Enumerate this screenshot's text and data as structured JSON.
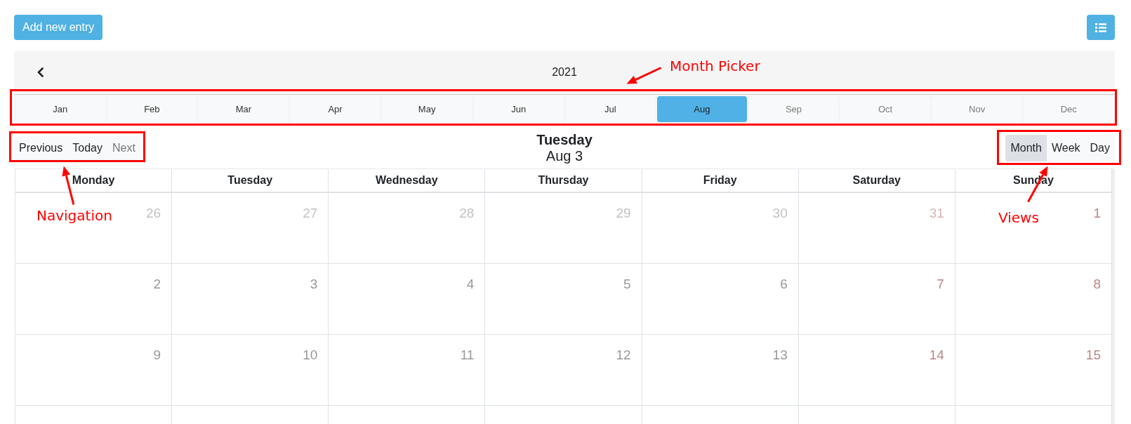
{
  "toolbar": {
    "add_button": "Add new entry"
  },
  "month_picker": {
    "year": "2021",
    "months": [
      {
        "label": "Jan",
        "selected": false,
        "disabled": false
      },
      {
        "label": "Feb",
        "selected": false,
        "disabled": false
      },
      {
        "label": "Mar",
        "selected": false,
        "disabled": false
      },
      {
        "label": "Apr",
        "selected": false,
        "disabled": false
      },
      {
        "label": "May",
        "selected": false,
        "disabled": false
      },
      {
        "label": "Jun",
        "selected": false,
        "disabled": false
      },
      {
        "label": "Jul",
        "selected": false,
        "disabled": false
      },
      {
        "label": "Aug",
        "selected": true,
        "disabled": false
      },
      {
        "label": "Sep",
        "selected": false,
        "disabled": true
      },
      {
        "label": "Oct",
        "selected": false,
        "disabled": true
      },
      {
        "label": "Nov",
        "selected": false,
        "disabled": true
      },
      {
        "label": "Dec",
        "selected": false,
        "disabled": true
      }
    ]
  },
  "navigation": [
    {
      "label": "Previous",
      "disabled": false
    },
    {
      "label": "Today",
      "disabled": false
    },
    {
      "label": "Next",
      "disabled": true
    }
  ],
  "heading": {
    "weekday": "Tuesday",
    "date": "Aug 3"
  },
  "views": [
    {
      "label": "Month",
      "selected": true
    },
    {
      "label": "Week",
      "selected": false
    },
    {
      "label": "Day",
      "selected": false
    }
  ],
  "calendar": {
    "columns": [
      "Monday",
      "Tuesday",
      "Wednesday",
      "Thursday",
      "Friday",
      "Saturday",
      "Sunday"
    ],
    "weeks": [
      {
        "days": [
          {
            "day": "26",
            "outside": true,
            "weekend": false
          },
          {
            "day": "27",
            "outside": true,
            "weekend": false
          },
          {
            "day": "28",
            "outside": true,
            "weekend": false
          },
          {
            "day": "29",
            "outside": true,
            "weekend": false
          },
          {
            "day": "30",
            "outside": true,
            "weekend": false
          },
          {
            "day": "31",
            "outside": true,
            "weekend": true
          },
          {
            "day": "1",
            "outside": false,
            "weekend": true
          }
        ]
      },
      {
        "days": [
          {
            "day": "2",
            "outside": false,
            "weekend": false
          },
          {
            "day": "3",
            "outside": false,
            "weekend": false
          },
          {
            "day": "4",
            "outside": false,
            "weekend": false
          },
          {
            "day": "5",
            "outside": false,
            "weekend": false
          },
          {
            "day": "6",
            "outside": false,
            "weekend": false
          },
          {
            "day": "7",
            "outside": false,
            "weekend": true
          },
          {
            "day": "8",
            "outside": false,
            "weekend": true
          }
        ]
      },
      {
        "days": [
          {
            "day": "9",
            "outside": false,
            "weekend": false
          },
          {
            "day": "10",
            "outside": false,
            "weekend": false
          },
          {
            "day": "11",
            "outside": false,
            "weekend": false
          },
          {
            "day": "12",
            "outside": false,
            "weekend": false
          },
          {
            "day": "13",
            "outside": false,
            "weekend": false
          },
          {
            "day": "14",
            "outside": false,
            "weekend": true
          },
          {
            "day": "15",
            "outside": false,
            "weekend": true
          }
        ]
      }
    ]
  },
  "annotations": [
    {
      "label": "Month Picker"
    },
    {
      "label": "Navigation"
    },
    {
      "label": "Views"
    }
  ]
}
